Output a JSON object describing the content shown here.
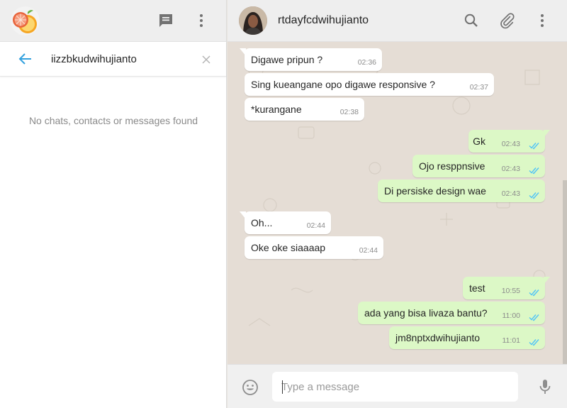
{
  "sidebar": {
    "header": {
      "app_avatar_icon": "grapefruit-avatar-icon",
      "new_chat_icon": "chat-icon",
      "menu_icon": "more-vertical-icon"
    },
    "search": {
      "back_icon": "arrow-left-icon",
      "value": "iizzbkudwihujianto",
      "clear_icon": "close-icon"
    },
    "empty_state": "No chats, contacts or messages found"
  },
  "conversation": {
    "contact_name": "rtdayfcdwihujianto",
    "header_icons": [
      "search-icon",
      "paperclip-icon",
      "more-vertical-icon"
    ],
    "messages": [
      {
        "direction": "in",
        "text": "Digawe pripun ?",
        "time": "02:36"
      },
      {
        "direction": "in",
        "text": "Sing kueangane opo digawe responsive ?",
        "time": "02:37"
      },
      {
        "direction": "in",
        "text": "*kurangane",
        "time": "02:38"
      },
      {
        "direction": "out",
        "text": "Gk",
        "time": "02:43",
        "status": "read"
      },
      {
        "direction": "out",
        "text": "Ojo resppnsive",
        "time": "02:43",
        "status": "read"
      },
      {
        "direction": "out",
        "text": "Di persiske design wae",
        "time": "02:43",
        "status": "read"
      },
      {
        "direction": "in",
        "text": "Oh...",
        "time": "02:44"
      },
      {
        "direction": "in",
        "text": "Oke oke siaaaap",
        "time": "02:44"
      },
      {
        "direction": "out",
        "text": "test",
        "time": "10:55",
        "status": "read"
      },
      {
        "direction": "out",
        "text": "ada yang bisa livaza bantu?",
        "time": "11:00",
        "status": "read"
      },
      {
        "direction": "out",
        "text": "jm8nptxdwihujianto",
        "time": "11:01",
        "status": "read"
      }
    ],
    "composer": {
      "placeholder": "Type a message",
      "emoji_icon": "smiley-icon",
      "mic_icon": "microphone-icon"
    }
  },
  "colors": {
    "header_bg": "#eeeeee",
    "chat_bg": "#e5ddd5",
    "incoming_bubble": "#ffffff",
    "outgoing_bubble": "#dcf8c6",
    "read_tick": "#4fc3f7",
    "accent": "#33a1de"
  }
}
